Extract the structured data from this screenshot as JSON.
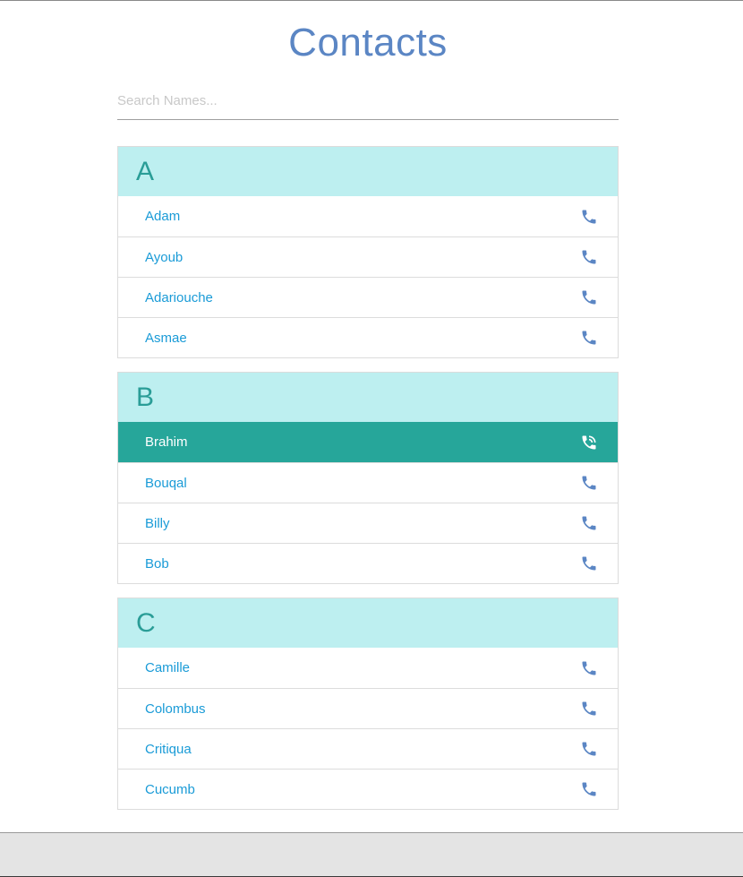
{
  "header": {
    "title": "Contacts"
  },
  "search": {
    "placeholder": "Search Names...",
    "value": ""
  },
  "groups": [
    {
      "letter": "A",
      "contacts": [
        {
          "name": "Adam"
        },
        {
          "name": "Ayoub"
        },
        {
          "name": "Adariouche"
        },
        {
          "name": "Asmae"
        }
      ]
    },
    {
      "letter": "B",
      "contacts": [
        {
          "name": "Brahim",
          "active": true
        },
        {
          "name": "Bouqal"
        },
        {
          "name": "Billy"
        },
        {
          "name": "Bob"
        }
      ]
    },
    {
      "letter": "C",
      "contacts": [
        {
          "name": "Camille"
        },
        {
          "name": "Colombus"
        },
        {
          "name": "Critiqua"
        },
        {
          "name": "Cucumb"
        }
      ]
    }
  ],
  "icons": {
    "row_icon": "phone-icon",
    "active_row_icon": "phone-in-talk-icon"
  },
  "colors": {
    "title": "#5b86c4",
    "group_header_bg": "#bdeff0",
    "group_letter": "#2a9d97",
    "contact_name": "#1a9bd7",
    "active_row_bg": "#26a69a",
    "phone_icon": "#5b86c4"
  }
}
